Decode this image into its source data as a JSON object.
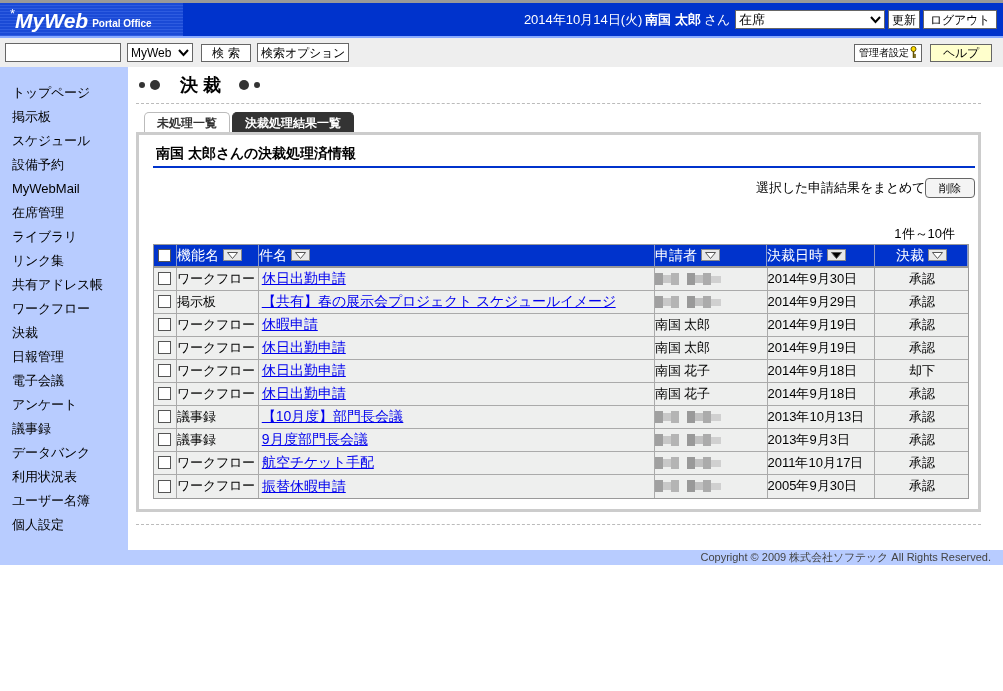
{
  "header": {
    "logo_main": "MyWeb",
    "logo_sub": "Portal Office",
    "logo_star": "*",
    "date": "2014年10月14日(火)",
    "user": "南国 太郎",
    "user_suffix": "さん",
    "status_select": "在席",
    "refresh_button": "更新",
    "logout_button": "ログアウト"
  },
  "toolbar": {
    "search_scope": "MyWeb",
    "search_button": "検 索",
    "search_options_button": "検索オプション",
    "admin_button": "管理者設定",
    "help_button": "ヘルプ"
  },
  "sidebar": {
    "items": [
      {
        "label": "トップページ",
        "selected": false
      },
      {
        "label": "掲示板",
        "selected": false
      },
      {
        "label": "スケジュール",
        "selected": false
      },
      {
        "label": "設備予約",
        "selected": false
      },
      {
        "label": "MyWebMail",
        "selected": false
      },
      {
        "label": "在席管理",
        "selected": false
      },
      {
        "label": "ライブラリ",
        "selected": false
      },
      {
        "label": "リンク集",
        "selected": false
      },
      {
        "label": "共有アドレス帳",
        "selected": false
      },
      {
        "label": "ワークフロー",
        "selected": false
      },
      {
        "label": "決裁",
        "selected": false
      },
      {
        "label": "日報管理",
        "selected": false
      },
      {
        "label": "電子会議",
        "selected": false
      },
      {
        "label": "アンケート",
        "selected": false
      },
      {
        "label": "議事録",
        "selected": false
      },
      {
        "label": "データバンク",
        "selected": false
      },
      {
        "label": "利用状況表",
        "selected": false
      },
      {
        "label": "ユーザー名簿",
        "selected": false
      },
      {
        "label": "個人設定",
        "selected": false
      }
    ]
  },
  "page_title": "決 裁",
  "tabs": [
    {
      "label": "未処理一覧",
      "selected": false
    },
    {
      "label": "決裁処理結果一覧",
      "selected": true
    }
  ],
  "section_title": "南国 太郎さんの決裁処理済情報",
  "bulk_action": {
    "label": "選択した申請結果をまとめて",
    "button": "削除"
  },
  "pagination": "1件～10件",
  "table": {
    "columns": [
      {
        "label": "機能名",
        "sorted": false
      },
      {
        "label": "件名",
        "sorted": false
      },
      {
        "label": "申請者",
        "sorted": false
      },
      {
        "label": "決裁日時",
        "sorted": true
      },
      {
        "label": "決裁",
        "sorted": false
      }
    ],
    "header_checked": false,
    "rows": [
      {
        "checked": false,
        "function": "ワークフロー",
        "subject": "休日出勤申請",
        "applicant_redacted": true,
        "date": "2014年9月30日",
        "result": "承認"
      },
      {
        "checked": false,
        "function": "掲示板",
        "subject": "【共有】春の展示会プロジェクト スケジュールイメージ",
        "applicant_redacted": true,
        "date": "2014年9月29日",
        "result": "承認"
      },
      {
        "checked": false,
        "function": "ワークフロー",
        "subject": "休暇申請",
        "applicant": "南国 太郎",
        "applicant_redacted": false,
        "date": "2014年9月19日",
        "result": "承認"
      },
      {
        "checked": false,
        "function": "ワークフロー",
        "subject": "休日出勤申請",
        "applicant": "南国 太郎",
        "applicant_redacted": false,
        "date": "2014年9月19日",
        "result": "承認"
      },
      {
        "checked": false,
        "function": "ワークフロー",
        "subject": "休日出勤申請",
        "applicant": "南国 花子",
        "applicant_redacted": false,
        "date": "2014年9月18日",
        "result": "却下"
      },
      {
        "checked": false,
        "function": "ワークフロー",
        "subject": "休日出勤申請",
        "applicant": "南国 花子",
        "applicant_redacted": false,
        "date": "2014年9月18日",
        "result": "承認"
      },
      {
        "checked": false,
        "function": "議事録",
        "subject": "【10月度】部門長会議",
        "applicant_redacted": true,
        "date": "2013年10月13日",
        "result": "承認"
      },
      {
        "checked": false,
        "function": "議事録",
        "subject": "9月度部門長会議",
        "applicant_redacted": true,
        "date": "2013年9月3日",
        "result": "承認"
      },
      {
        "checked": false,
        "function": "ワークフロー",
        "subject": "航空チケット手配",
        "applicant_redacted": true,
        "date": "2011年10月17日",
        "result": "承認"
      },
      {
        "checked": false,
        "function": "ワークフロー",
        "subject": "振替休暇申請",
        "applicant_redacted": true,
        "date": "2005年9月30日",
        "result": "承認"
      }
    ]
  },
  "footer": {
    "copyright": "Copyright © 2009 株式会社ソフテック All Rights Reserved."
  }
}
